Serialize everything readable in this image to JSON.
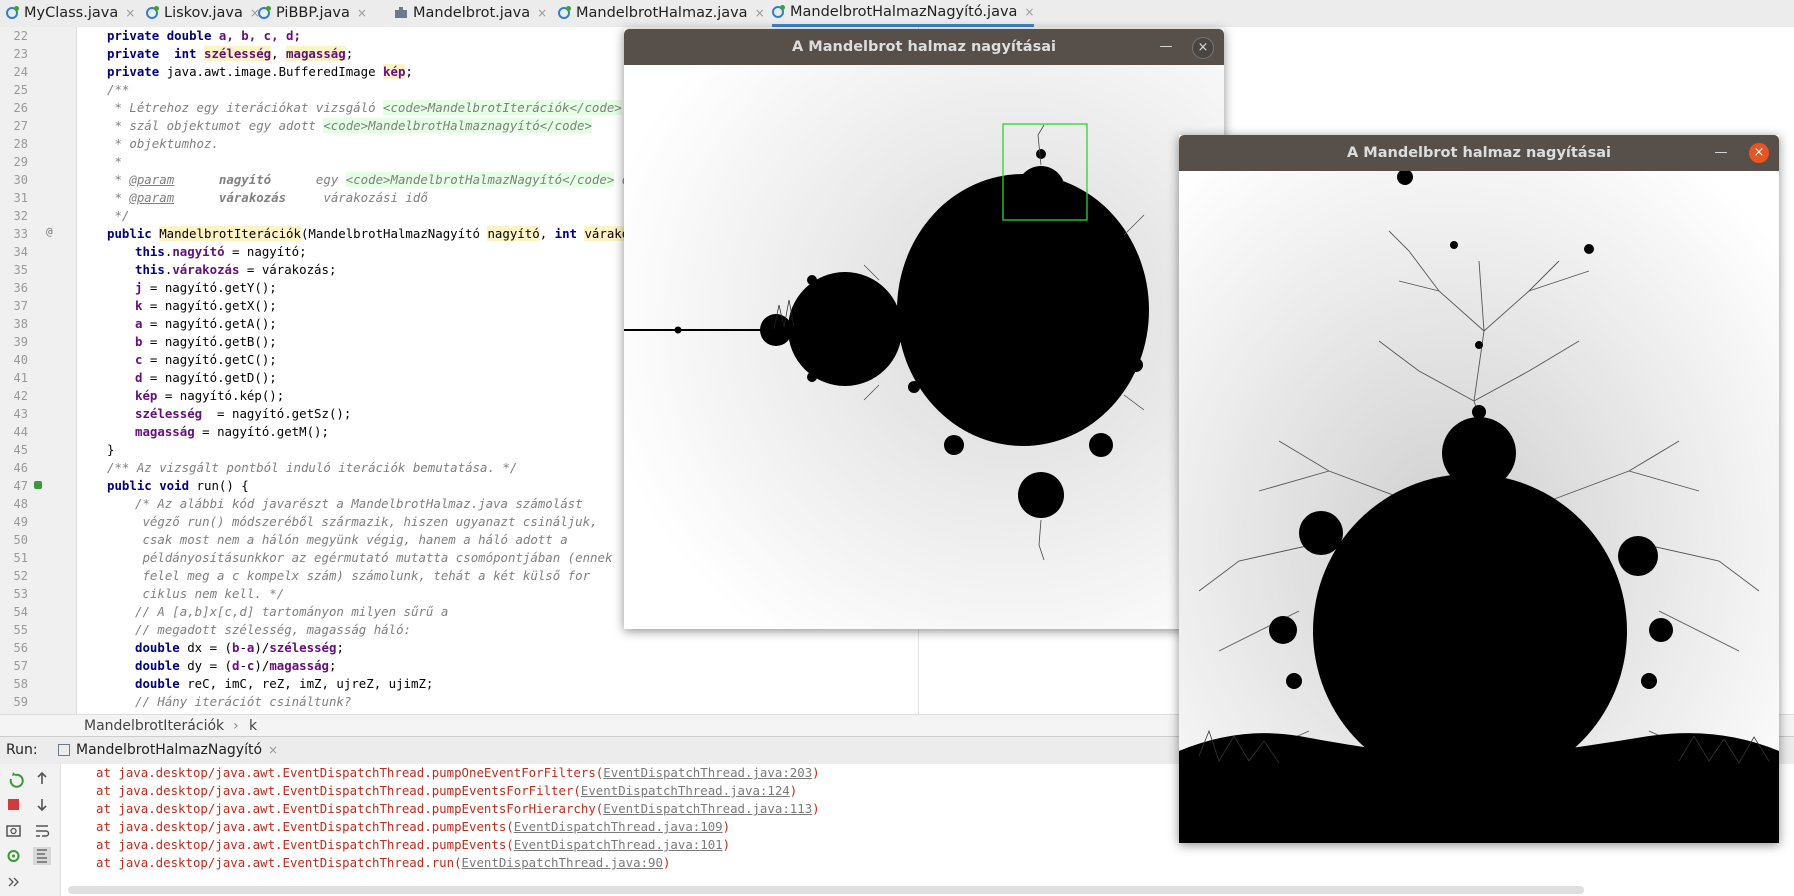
{
  "tabs": [
    {
      "label": "MyClass.java",
      "icon": "java-class-icon"
    },
    {
      "label": "Liskov.java",
      "icon": "java-class-icon"
    },
    {
      "label": "PiBBP.java",
      "icon": "java-class-icon"
    },
    {
      "label": "Mandelbrot.java",
      "icon": "java-file-icon"
    },
    {
      "label": "MandelbrotHalmaz.java",
      "icon": "java-class-icon"
    },
    {
      "label": "MandelbrotHalmazNagyító.java",
      "icon": "java-class-icon",
      "active": true
    }
  ],
  "tab_close": "×",
  "gutter": {
    "line_numbers": [
      "22",
      "23",
      "24",
      "25",
      "26",
      "27",
      "28",
      "29",
      "30",
      "31",
      "32",
      "33",
      "34",
      "35",
      "36",
      "37",
      "38",
      "39",
      "40",
      "41",
      "42",
      "43",
      "44",
      "45",
      "46",
      "47",
      "48",
      "49",
      "50",
      "51",
      "52",
      "53",
      "54",
      "55",
      "56",
      "57",
      "58",
      "59"
    ],
    "override_mark": "@"
  },
  "code": {
    "l22": [
      "private ",
      "double ",
      "a, b, c, d;"
    ],
    "l23": [
      "private  ",
      "int ",
      "szélesség",
      ", ",
      "magasság",
      ";"
    ],
    "l24": [
      "private ",
      "java.awt.image.BufferedImage ",
      "kép",
      ";"
    ],
    "l25": "/**",
    "l26": [
      " * Létrehoz egy iterációkat vizsgáló ",
      "<code>",
      "MandelbrotIterációk",
      "</code>"
    ],
    "l27": [
      " * szál objektumot egy adott ",
      "<code>",
      "MandelbrotHalmaznagyító",
      "</code>"
    ],
    "l28": " * objektumhoz.",
    "l29": " *",
    "l30": [
      " * ",
      "@param",
      "      nagyító",
      "      egy ",
      "<code>",
      "MandelbrotHalmazNagyító",
      "</code>",
      " objek"
    ],
    "l31": [
      " * ",
      "@param",
      "      várakozás",
      "     várakozási idő"
    ],
    "l32": " */",
    "l33": [
      "public ",
      "MandelbrotIterációk",
      "(MandelbrotHalmazNagyító ",
      "nagyító",
      ", ",
      "int ",
      "várakozás",
      ")"
    ],
    "l34": [
      "this",
      ".",
      "nagyító",
      " = nagyító;"
    ],
    "l35": [
      "this",
      ".",
      "várakozás",
      " = várakozás;"
    ],
    "l36": [
      "j",
      " = nagyító.getY();"
    ],
    "l37": [
      "k",
      " = nagyító.getX();"
    ],
    "l38": [
      "a",
      " = nagyító.getA();"
    ],
    "l39": [
      "b",
      " = nagyító.getB();"
    ],
    "l40": [
      "c",
      " = nagyító.getC();"
    ],
    "l41": [
      "d",
      " = nagyító.getD();"
    ],
    "l42": [
      "kép",
      " = nagyító.kép();"
    ],
    "l43": [
      "szélesség",
      "  = nagyító.getSz();"
    ],
    "l44": [
      "magasság",
      " = nagyító.getM();"
    ],
    "l45": "}",
    "l46": "/** Az vizsgált pontból induló iterációk bemutatása. */",
    "l47": [
      "public ",
      "void ",
      "run() {"
    ],
    "l48": "/* Az alábbi kód javarészt a MandelbrotHalmaz.java számolást",
    "l49": " végző run() módszeréből származik, hiszen ugyanazt csináljuk,",
    "l50": " csak most nem a hálón megyünk végig, hanem a háló adott a",
    "l51": " példányosításunkkor az egérmutató mutatta csomópontjában (ennek",
    "l52": " felel meg a c kompelx szám) számolunk, tehát a két külső for",
    "l53": " ciklus nem kell. */",
    "l54": "// A [a,b]x[c,d] tartományon milyen sűrű a",
    "l55": "// megadott szélesség, magasság háló:",
    "l56": [
      "double ",
      "dx = (",
      "b",
      "-",
      "a",
      ")/",
      "szélesség",
      ";"
    ],
    "l57": [
      "double ",
      "dy = (",
      "d",
      "-",
      "c",
      ")/",
      "magasság",
      ";"
    ],
    "l58": [
      "double ",
      "reC, imC, reZ, imZ, ujreZ, ujimZ;"
    ],
    "l59": "// Hány iterációt csináltunk?"
  },
  "breadcrumb": {
    "class": "MandelbrotIterációk",
    "sep": "›",
    "member": "k"
  },
  "run": {
    "label": "Run:",
    "tab": "MandelbrotHalmazNagyító",
    "close": "×",
    "lines": [
      {
        "text": "at java.desktop/java.awt.EventDispatchThread.pumpOneEventForFilters(",
        "link": "EventDispatchThread.java:203",
        "end": ")"
      },
      {
        "text": "at java.desktop/java.awt.EventDispatchThread.pumpEventsForFilter(",
        "link": "EventDispatchThread.java:124",
        "end": ")"
      },
      {
        "text": "at java.desktop/java.awt.EventDispatchThread.pumpEventsForHierarchy(",
        "link": "EventDispatchThread.java:113",
        "end": ")"
      },
      {
        "text": "at java.desktop/java.awt.EventDispatchThread.pumpEvents(",
        "link": "EventDispatchThread.java:109",
        "end": ")"
      },
      {
        "text": "at java.desktop/java.awt.EventDispatchThread.pumpEvents(",
        "link": "EventDispatchThread.java:101",
        "end": ")"
      },
      {
        "text": "at java.desktop/java.awt.EventDispatchThread.run(",
        "link": "EventDispatchThread.java:90",
        "end": ")"
      }
    ],
    "tools": [
      "rerun-icon",
      "up-arrow-icon",
      "stop-icon",
      "down-arrow-icon",
      "camera-icon",
      "wrap-icon",
      "settings-icon",
      "scroll-end-icon",
      "expand-icon"
    ]
  },
  "window1": {
    "title": "A Mandelbrot halmaz nagyításai",
    "minimize": "—",
    "close": "×",
    "close_color": "#4a4541"
  },
  "window2": {
    "title": "A Mandelbrot halmaz nagyításai",
    "minimize": "—",
    "close": "×",
    "close_color": "#e95420"
  },
  "colors": {
    "selection": "#2bd62b",
    "titlebar": "#57504a",
    "accent": "#4083c9"
  }
}
